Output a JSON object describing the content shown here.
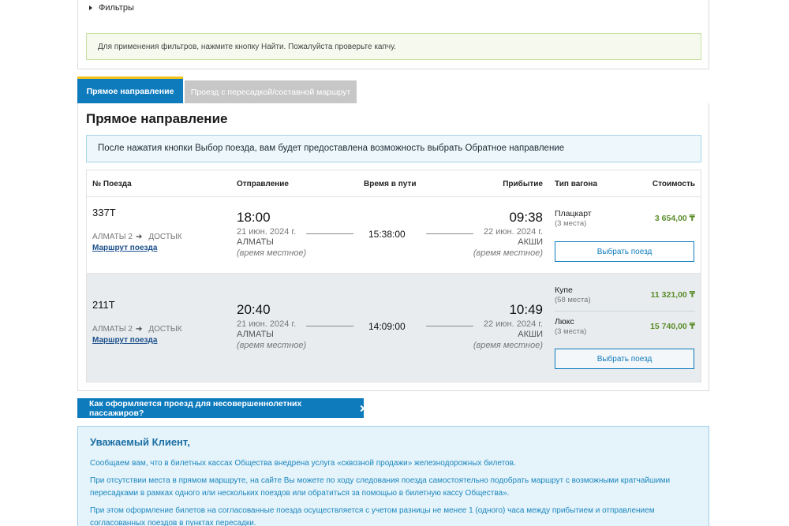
{
  "filters": {
    "toggle_label": "Фильтры",
    "note": "Для применения фильтров, нажмите кнопку Найти. Пожалуйста проверьте капчу."
  },
  "tabs": {
    "direct": "Прямое направление",
    "transfer": "Проезд с пересадкой/составной маршрут"
  },
  "direct": {
    "title": "Прямое направление",
    "info": "После нажатия кнопки Выбор поезда, вам будет предоставлена возможность выбрать Обратное направление",
    "headers": {
      "train": "№ Поезда",
      "departure": "Отправление",
      "travel": "Время в пути",
      "arrival": "Прибытие",
      "car_type": "Тип вагона",
      "price": "Стоимость"
    },
    "trains": [
      {
        "number": "337Т",
        "route_from": "АЛМАТЫ 2",
        "route_to": "ДОСТЫК",
        "route_link": "Маршрут поезда",
        "dep_time": "18:00",
        "dep_date": "21 июн. 2024 г.",
        "dep_city": "АЛМАТЫ",
        "dep_note": "(время местное)",
        "travel_time": "15:38:00",
        "arr_time": "09:38",
        "arr_date": "22 июн. 2024 г.",
        "arr_city": "АКШИ",
        "arr_note": "(время местное)",
        "cars": [
          {
            "type": "Плацкарт",
            "seats": "(3 места)",
            "price": "3 654,00 ₸"
          }
        ],
        "select_label": "Выбрать поезд"
      },
      {
        "number": "211Т",
        "route_from": "АЛМАТЫ 2",
        "route_to": "ДОСТЫК",
        "route_link": "Маршрут поезда",
        "dep_time": "20:40",
        "dep_date": "21 июн. 2024 г.",
        "dep_city": "АЛМАТЫ",
        "dep_note": "(время местное)",
        "travel_time": "14:09:00",
        "arr_time": "10:49",
        "arr_date": "22 июн. 2024 г.",
        "arr_city": "АКШИ",
        "arr_note": "(время местное)",
        "cars": [
          {
            "type": "Купе",
            "seats": "(58 места)",
            "price": "11 321,00 ₸"
          },
          {
            "type": "Люкс",
            "seats": "(3 места)",
            "price": "15 740,00 ₸"
          }
        ],
        "select_label": "Выбрать поезд"
      }
    ]
  },
  "minors_link": "Как оформляется проезд для несовершеннолетних пассажиров?",
  "notice": {
    "title": "Уважаемый Клиент,",
    "p1": "Сообщаем вам, что в билетных кассах Общества внедрена услуга «сквозной продажи» железнодорожных билетов.",
    "p2": "При отсутствии места в прямом маршруте, на сайте Вы можете по ходу следования поезда самостоятельно подобрать маршрут с возможными кратчайшими пересадками в рамках одного или нескольких поездов или обратиться за помощью в билетную кассу Общества».",
    "p3": "При этом оформление билетов на согласованные поезда осуществляется с учетом разницы не менее 1 (одного) часа между прибытием и отправлением согласованных поездов в пунктах пересадки."
  },
  "colors": {
    "accent_blue": "#0e7bbd",
    "tab_highlight": "#f3c21b",
    "price_green": "#5b8c2a"
  }
}
